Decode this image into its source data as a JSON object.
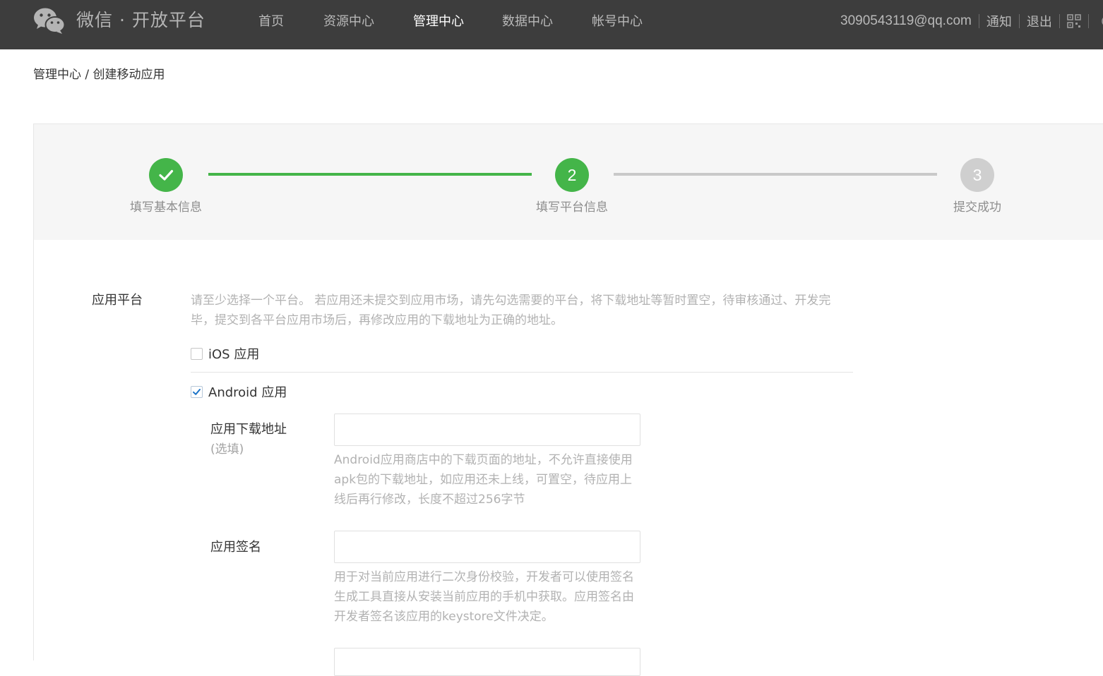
{
  "header": {
    "brand": "微信 · 开放平台",
    "logo_icon": "wechat-logo-icon",
    "nav": [
      {
        "label": "首页",
        "active": false
      },
      {
        "label": "资源中心",
        "active": false
      },
      {
        "label": "管理中心",
        "active": true
      },
      {
        "label": "数据中心",
        "active": false
      },
      {
        "label": "帐号中心",
        "active": false
      }
    ],
    "user_email": "3090543119@qq.com",
    "notify_label": "通知",
    "logout_label": "退出",
    "qr_icon": "qr-code-icon",
    "globe_icon": "globe-icon"
  },
  "breadcrumb": {
    "parent": "管理中心",
    "separator": " / ",
    "current": "创建移动应用"
  },
  "steps": [
    {
      "number": "1",
      "label": "填写基本信息",
      "status": "done"
    },
    {
      "number": "2",
      "label": "填写平台信息",
      "status": "current"
    },
    {
      "number": "3",
      "label": "提交成功",
      "status": "pending"
    }
  ],
  "form": {
    "platform_label": "应用平台",
    "platform_hint": "请至少选择一个平台。 若应用还未提交到应用市场，请先勾选需要的平台，将下载地址等暂时置空，待审核通过、开发完毕，提交到各平台应用市场后，再修改应用的下载地址为正确的地址。",
    "ios": {
      "label": "iOS 应用",
      "checked": false
    },
    "android": {
      "label": "Android 应用",
      "checked": true
    },
    "download_url": {
      "label": "应用下载地址",
      "optional": "(选填)",
      "value": "",
      "hint": "Android应用商店中的下载页面的地址，不允许直接使用apk包的下载地址，如应用还未上线，可置空，待应用上线后再行修改，长度不超过256字节"
    },
    "signature": {
      "label": "应用签名",
      "value": "",
      "hint": "用于对当前应用进行二次身份校验，开发者可以使用签名生成工具直接从安装当前应用的手机中获取。应用签名由开发者签名该应用的keystore文件决定。"
    }
  },
  "colors": {
    "header_bg": "#3d3d3d",
    "accent_green": "#44b549",
    "pending_grey": "#cfcfcf",
    "steps_bg": "#f6f6f6",
    "hint_text": "#b2b2b2"
  }
}
